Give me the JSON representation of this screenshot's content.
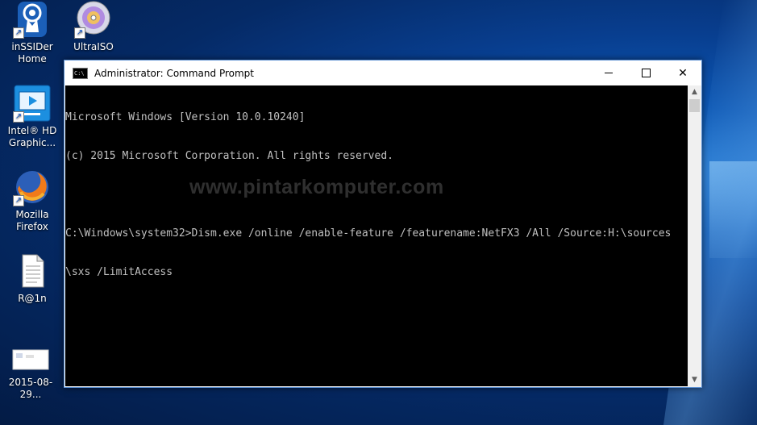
{
  "desktop": {
    "icons": [
      {
        "label_line1": "inSSIDer",
        "label_line2": "Home",
        "icon": "inssider-icon"
      },
      {
        "label_line1": "UltraISO",
        "label_line2": "",
        "icon": "ultraiso-disc-icon"
      },
      {
        "label_line1": "Intel® HD",
        "label_line2": "Graphic...",
        "icon": "intel-graphics-icon"
      },
      {
        "label_line1": "Mozilla",
        "label_line2": "Firefox",
        "icon": "firefox-icon"
      },
      {
        "label_line1": "R@1n",
        "label_line2": "",
        "icon": "text-document-icon"
      },
      {
        "label_line1": "2015-08-29...",
        "label_line2": "",
        "icon": "image-thumbnail-icon"
      }
    ]
  },
  "window": {
    "title": "Administrator: Command Prompt",
    "icon": "cmd-icon",
    "controls": {
      "minimize": "minimize-icon",
      "maximize": "maximize-icon",
      "close": "✕"
    }
  },
  "console": {
    "lines": [
      "Microsoft Windows [Version 10.0.10240]",
      "(c) 2015 Microsoft Corporation. All rights reserved.",
      "",
      "C:\\Windows\\system32>Dism.exe /online /enable-feature /featurename:NetFX3 /All /Source:H:\\sources",
      "\\sxs /LimitAccess"
    ],
    "watermark": "www.pintarkomputer.com"
  },
  "colors": {
    "console_bg": "#000000",
    "console_text": "#c0c0c0",
    "desktop_accent": "#0d57b3"
  }
}
